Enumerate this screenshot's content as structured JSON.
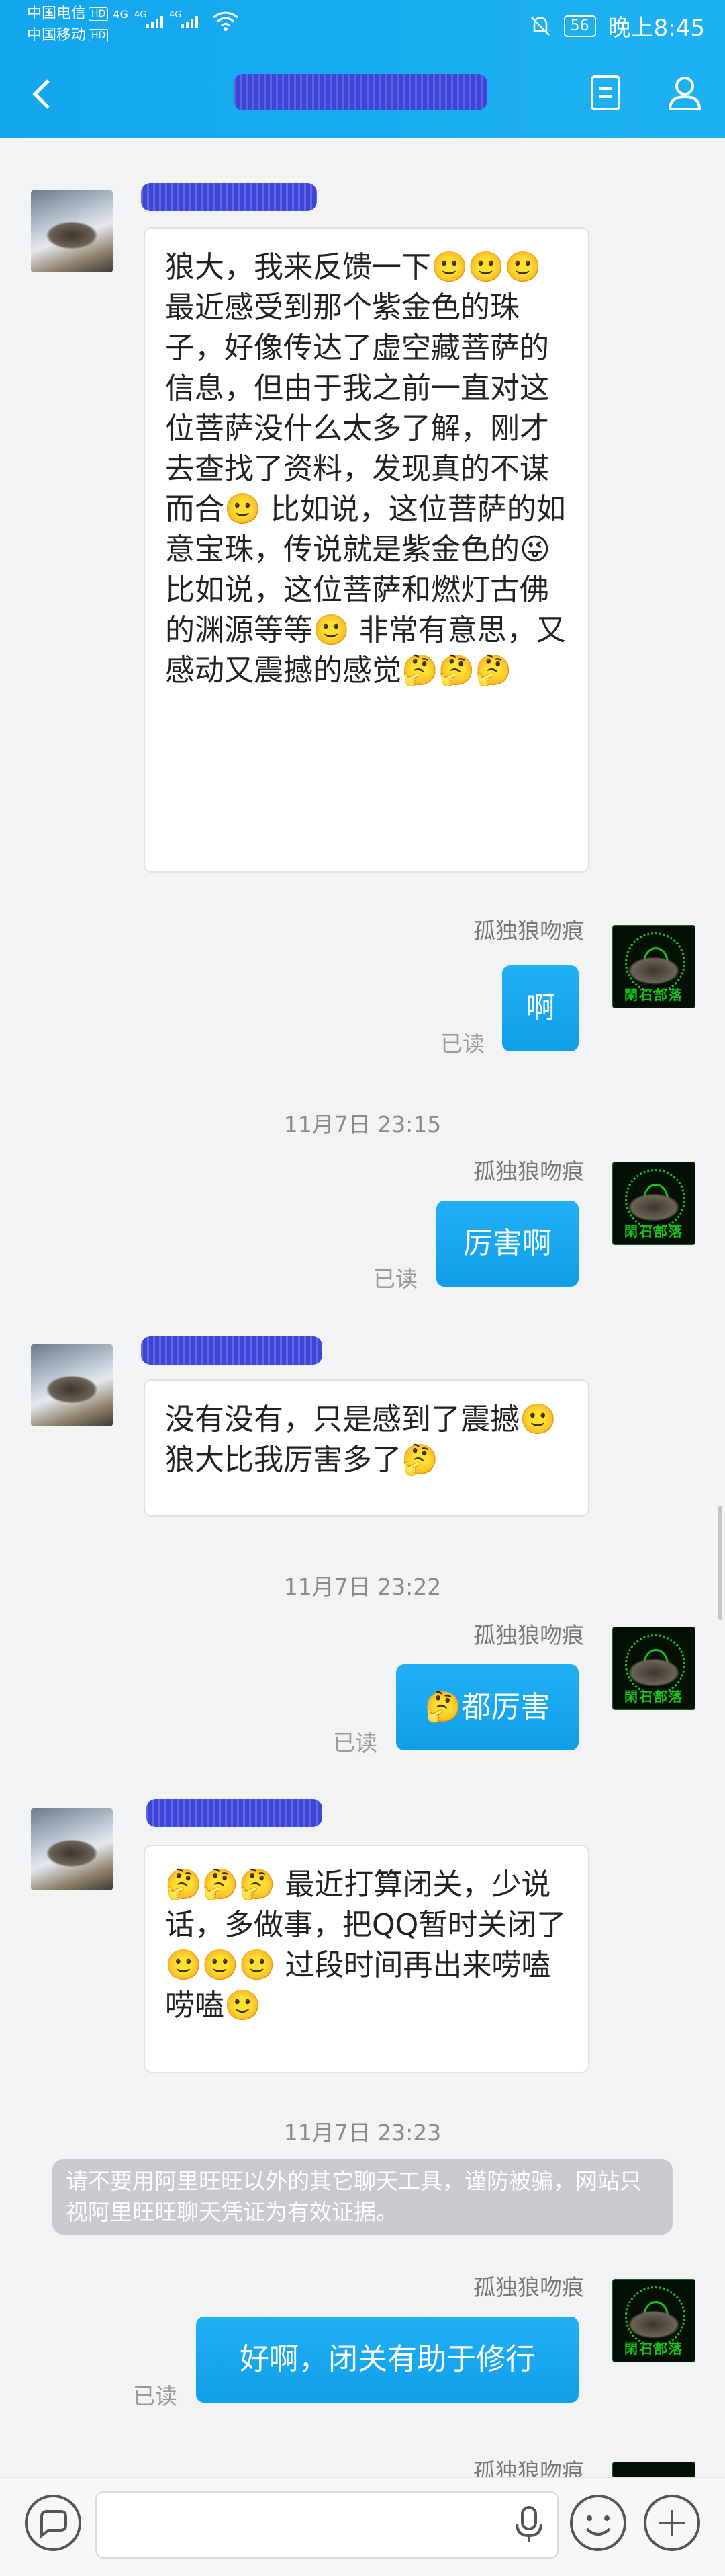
{
  "status_bar": {
    "carrier_1": "中国电信",
    "carrier_2": "中国移动",
    "hd": "HD",
    "network": "4G",
    "battery": "56",
    "time": "晚上8:45"
  },
  "nav": {
    "title": ""
  },
  "messages": [
    {
      "text": "狼大，我来反馈一下🙂🙂🙂 最近感受到那个紫金色的珠子，好像传达了虚空藏菩萨的信息，但由于我之前一直对这位菩萨没什么太多了解，刚才去查找了资料，发现真的不谋而合🙂 比如说，这位菩萨的如意宝珠，传说就是紫金色的😜 比如说，这位菩萨和燃灯古佛的渊源等等🙂 非常有意思，又感动又震撼的感觉🤔🤔🤔"
    },
    {
      "sender": "孤独狼吻痕",
      "text": "啊",
      "read": "已读"
    },
    {
      "time": "11月7日 23:15"
    },
    {
      "sender": "孤独狼吻痕",
      "text": "厉害啊",
      "read": "已读"
    },
    {
      "text": "没有没有，只是感到了震撼🙂 狼大比我厉害多了🤔"
    },
    {
      "time": "11月7日 23:22"
    },
    {
      "sender": "孤独狼吻痕",
      "text": "🤔都厉害",
      "read": "已读"
    },
    {
      "text": "🤔🤔🤔 最近打算闭关，少说话，多做事，把QQ暂时关闭了🙂🙂🙂 过段时间再出来唠嗑唠嗑🙂"
    },
    {
      "time": "11月7日 23:23"
    },
    {
      "notice": "请不要用阿里旺旺以外的其它聊天工具，谨防被骗，网站只视阿里旺旺聊天凭证为有效证据。"
    },
    {
      "sender": "孤独狼吻痕",
      "text": "好啊，闭关有助于修行",
      "read": "已读"
    },
    {
      "sender": "孤独狼吻痕"
    }
  ],
  "avatar_wolf_text": "閑石部落",
  "colors": {
    "accent": "#13a6ee",
    "bubble_right": "#1aa8f0",
    "name_blur": "#3d46d9"
  },
  "icons": [
    "back-arrow-icon",
    "document-icon",
    "person-icon",
    "chat-bubble-icon",
    "microphone-icon",
    "smiley-icon",
    "plus-icon"
  ]
}
